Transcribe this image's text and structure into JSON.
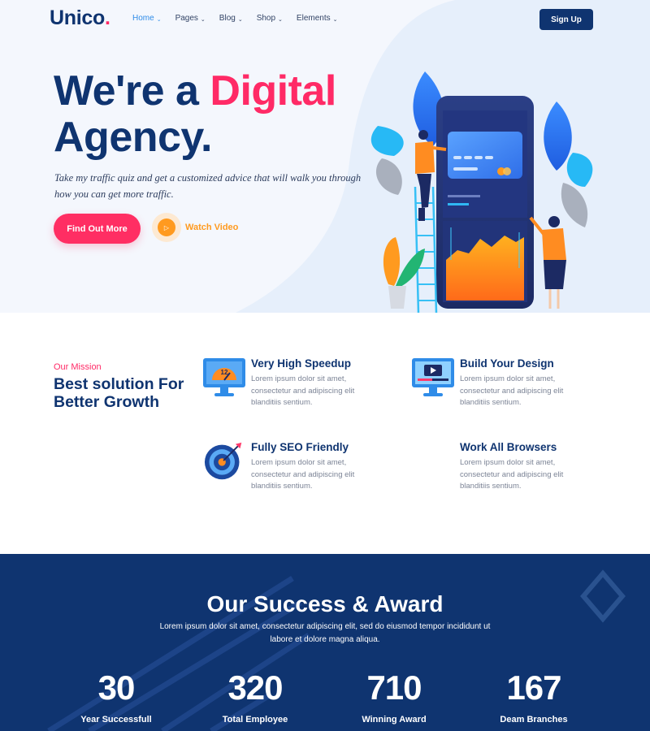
{
  "brand": {
    "name": "Unico",
    "dot": "."
  },
  "nav": {
    "items": [
      {
        "label": "Home",
        "active": true
      },
      {
        "label": "Pages",
        "active": false
      },
      {
        "label": "Blog",
        "active": false
      },
      {
        "label": "Shop",
        "active": false
      },
      {
        "label": "Elements",
        "active": false
      }
    ],
    "chevron": "⌄",
    "signup_label": "Sign Up"
  },
  "hero": {
    "title_part1": "We're a ",
    "title_accent": "Digital",
    "title_part2": "Agency.",
    "description": "Take my traffic quiz and get a customized advice that will walk you through how you can get more traffic.",
    "primary_button": "Find Out More",
    "video_label": "Watch Video",
    "illustration_clock": "12"
  },
  "mission": {
    "kicker": "Our Mission",
    "title": "Best solution For Better Growth"
  },
  "features": [
    {
      "title": "Very High Speedup",
      "text": "Lorem ipsum dolor sit amet, consectetur and adipiscing elit blanditiis sentium.",
      "icon": "speed-monitor-icon"
    },
    {
      "title": "Build Your Design",
      "text": "Lorem ipsum dolor sit amet, consectetur and adipiscing elit blanditiis sentium.",
      "icon": "video-design-icon"
    },
    {
      "title": "Fully SEO Friendly",
      "text": "Lorem ipsum dolor sit amet, consectetur and adipiscing elit blanditiis sentium.",
      "icon": "target-icon"
    },
    {
      "title": "Work All Browsers",
      "text": "Lorem ipsum dolor sit amet, consectetur and adipiscing elit blanditiis sentium.",
      "icon": "browser-icon"
    }
  ],
  "stats": {
    "title": "Our Success & Award",
    "subtitle": "Lorem ipsum dolor sit amet, consectetur adipiscing elit, sed do eiusmod tempor incididunt ut labore et dolore magna aliqua.",
    "items": [
      {
        "value": "30",
        "label": "Year Successfull"
      },
      {
        "value": "320",
        "label": "Total Employee"
      },
      {
        "value": "710",
        "label": "Winning Award"
      },
      {
        "value": "167",
        "label": "Deam Branches"
      }
    ]
  },
  "colors": {
    "navy": "#0f3470",
    "accent_pink": "#ff2a66",
    "accent_orange": "#ff9a1f",
    "link_blue": "#2f8ce8",
    "hero_bg": "#f4f7fd"
  }
}
